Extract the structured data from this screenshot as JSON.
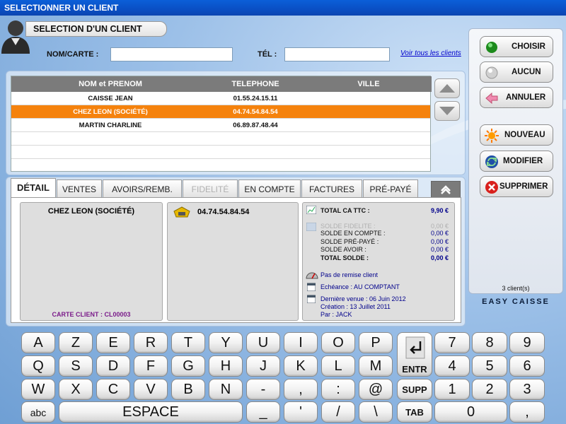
{
  "window": {
    "title": "SELECTIONNER UN CLIENT"
  },
  "header": {
    "title": "SELECTION D'UN CLIENT",
    "name_label": "NOM/CARTE :",
    "name_value": "",
    "phone_label": "TÉL :",
    "phone_value": "",
    "see_all_link": "Voir tous les clients"
  },
  "table": {
    "columns": [
      "NOM et PRENOM",
      "TELEPHONE",
      "VILLE"
    ],
    "rows": [
      {
        "name": "CAISSE JEAN",
        "phone": "01.55.24.15.11",
        "city": ""
      },
      {
        "name": "CHEZ LEON (SOCIÉTÉ)",
        "phone": "04.74.54.84.54",
        "city": "",
        "selected": true
      },
      {
        "name": "MARTIN CHARLINE",
        "phone": "06.89.87.48.44",
        "city": ""
      }
    ]
  },
  "tabs": [
    {
      "label": "DÉTAIL",
      "active": true
    },
    {
      "label": "VENTES"
    },
    {
      "label": "AVOIRS/REMB."
    },
    {
      "label": "FIDELITÉ",
      "disabled": true
    },
    {
      "label": "EN COMPTE"
    },
    {
      "label": "FACTURES"
    },
    {
      "label": "PRÉ-PAYÉ"
    }
  ],
  "detail": {
    "client_name": "CHEZ LEON (SOCIÉTÉ)",
    "client_card": "CARTE CLIENT : CL00003",
    "phone": "04.74.54.84.54",
    "summary": {
      "total_ca_label": "TOTAL CA TTC :",
      "total_ca_value": "9,90 €",
      "fidelity_label": "SOLDE FIDELITE :",
      "fidelity_value": "0,00 €",
      "account_label": "SOLDE EN COMPTE :",
      "account_value": "0,00 €",
      "prepaid_label": "SOLDE PRÉ-PAYÉ :",
      "prepaid_value": "0,00 €",
      "credit_label": "SOLDE AVOIR :",
      "credit_value": "0,00 €",
      "total_label": "TOTAL SOLDE :",
      "total_value": "0,00 €"
    },
    "discount": "Pas de remise client",
    "due": "Echéance : AU COMPTANT",
    "last_visit": "Dernière venue : 06 Juin 2012",
    "created": "Création : 13 Juillet 2011",
    "by": "Par : JACK"
  },
  "actions": {
    "choose": "CHOISIR",
    "none": "AUCUN",
    "cancel": "ANNULER",
    "new": "NOUVEAU",
    "edit": "MODIFIER",
    "delete": "SUPPRIMER"
  },
  "status": {
    "client_count": "3 client(s)",
    "brand": "EASY CAISSE"
  },
  "keyboard": {
    "row1": [
      "A",
      "Z",
      "E",
      "R",
      "T",
      "Y",
      "U",
      "I",
      "O",
      "P"
    ],
    "row2": [
      "Q",
      "S",
      "D",
      "F",
      "G",
      "H",
      "J",
      "K",
      "L",
      "M"
    ],
    "row3": [
      "W",
      "X",
      "C",
      "V",
      "B",
      "N",
      "-",
      ",",
      ":",
      "@"
    ],
    "abc": "abc",
    "space": "ESPACE",
    "underscore": "_",
    "apostrophe": "'",
    "slash": "/",
    "backslash": "\\",
    "enter": "ENTR",
    "supp": "SUPP",
    "tab": "TAB",
    "numpad": [
      [
        "7",
        "8",
        "9"
      ],
      [
        "4",
        "5",
        "6"
      ],
      [
        "1",
        "2",
        "3"
      ]
    ],
    "zero": "0",
    "comma": ","
  }
}
